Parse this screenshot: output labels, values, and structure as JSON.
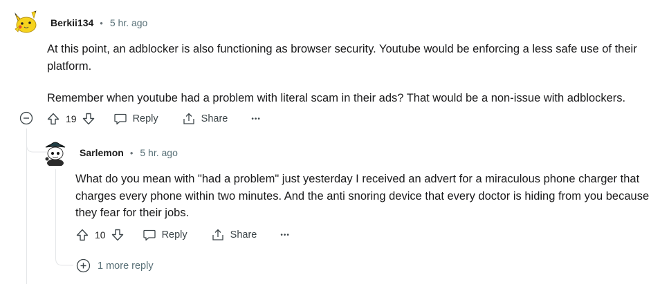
{
  "comment": {
    "username": "Berkii134",
    "separator": "•",
    "timestamp": "5 hr. ago",
    "paragraphs": [
      "At this point, an adblocker is also functioning as browser security. Youtube would be enforcing a less safe use of their platform.",
      "Remember when youtube had a problem with literal scam in their ads? That would be a non-issue with adblockers."
    ],
    "votes": "19",
    "reply_label": "Reply",
    "share_label": "Share",
    "more_label": "•••"
  },
  "reply": {
    "username": "Sarlemon",
    "separator": "•",
    "timestamp": "5 hr. ago",
    "text": "What do you mean with \"had a problem\" just yesterday I received an advert for a miraculous phone charger that charges every phone within two minutes. And the anti snoring device that every doctor is hiding from you because they fear for their jobs.",
    "votes": "10",
    "reply_label": "Reply",
    "share_label": "Share",
    "more_label": "•••"
  },
  "more_replies_label": "1 more reply",
  "colors": {
    "line": "#e4e6e8",
    "meta": "#576f76",
    "text": "#1a1a1b"
  }
}
